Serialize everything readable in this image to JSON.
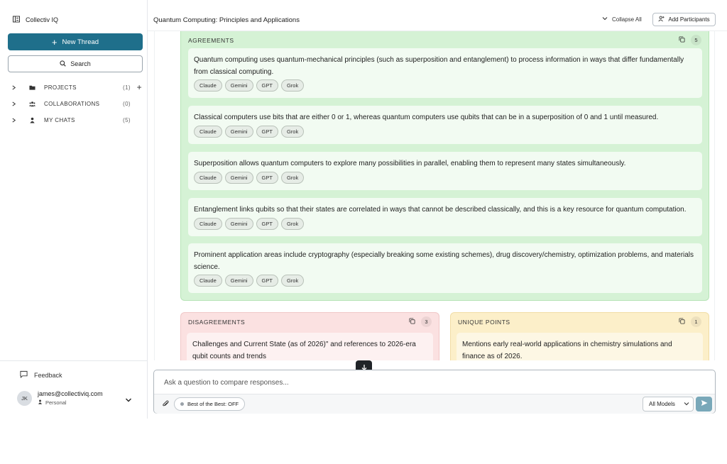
{
  "sidebar": {
    "brand": "Collectiv IQ",
    "new_thread": "New Thread",
    "search": "Search",
    "nav": [
      {
        "label": "PROJECTS",
        "count": "(1)"
      },
      {
        "label": "COLLABORATIONS",
        "count": "(0)"
      },
      {
        "label": "MY CHATS",
        "count": "(5)"
      }
    ],
    "feedback": "Feedback",
    "user": {
      "initials": "JK",
      "email": "james@collectiviq.com",
      "plan": "Personal"
    }
  },
  "header": {
    "title": "Quantum Computing: Principles and Applications",
    "collapse_all": "Collapse All",
    "add_participants": "Add Participants"
  },
  "agreements": {
    "title": "AGREEMENTS",
    "count": "5",
    "points": [
      {
        "text": "Quantum computing uses quantum-mechanical principles (such as superposition and entanglement) to process information in ways that differ fundamentally from classical computing.",
        "models": [
          "Claude",
          "Gemini",
          "GPT",
          "Grok"
        ]
      },
      {
        "text": "Classical computers use bits that are either 0 or 1, whereas quantum computers use qubits that can be in a superposition of 0 and 1 until measured.",
        "models": [
          "Claude",
          "Gemini",
          "GPT",
          "Grok"
        ]
      },
      {
        "text": "Superposition allows quantum computers to explore many possibilities in parallel, enabling them to represent many states simultaneously.",
        "models": [
          "Claude",
          "Gemini",
          "GPT",
          "Grok"
        ]
      },
      {
        "text": "Entanglement links qubits so that their states are correlated in ways that cannot be described classically, and this is a key resource for quantum computation.",
        "models": [
          "Claude",
          "Gemini",
          "GPT",
          "Grok"
        ]
      },
      {
        "text": "Prominent application areas include cryptography (especially breaking some existing schemes), drug discovery/chemistry, optimization problems, and materials science.",
        "models": [
          "Claude",
          "Gemini",
          "GPT",
          "Grok"
        ]
      }
    ]
  },
  "disagreements": {
    "title": "DISAGREEMENTS",
    "count": "3",
    "first_point": "Challenges and Current State (as of 2026)\" and references to 2026-era qubit counts and trends"
  },
  "unique_points": {
    "title": "UNIQUE POINTS",
    "count": "1",
    "first_point": "Mentions early real-world applications in chemistry simulations and finance as of 2026."
  },
  "composer": {
    "placeholder": "Ask a question to compare responses...",
    "best_of_best": "Best of the Best: OFF",
    "model_select": "All Models"
  },
  "colors": {
    "primary": "#1f6f8b",
    "agree_bg": "#d5f2d5",
    "disagree_bg": "#fbe1e1",
    "unique_bg": "#fcefc9",
    "send_bg": "#79a8b9"
  }
}
